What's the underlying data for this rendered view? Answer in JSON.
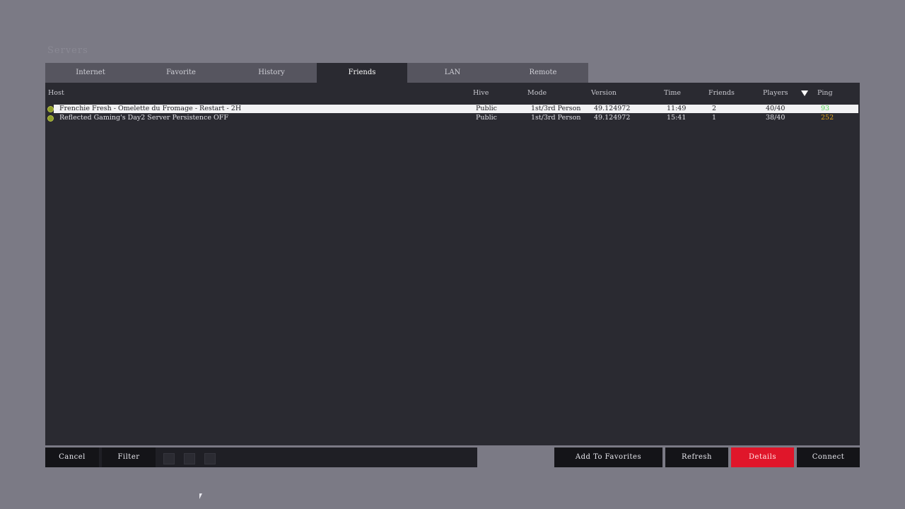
{
  "window": {
    "title": "Servers"
  },
  "tabs": [
    {
      "label": "Internet",
      "active": false
    },
    {
      "label": "Favorite",
      "active": false
    },
    {
      "label": "History",
      "active": false
    },
    {
      "label": "Friends",
      "active": true
    },
    {
      "label": "LAN",
      "active": false
    },
    {
      "label": "Remote",
      "active": false
    }
  ],
  "table": {
    "columns": [
      "Host",
      "Hive",
      "Mode",
      "Version",
      "Time",
      "Friends",
      "Players",
      "Ping"
    ],
    "rows": [
      {
        "host": "Frenchie Fresh - Omelette du Fromage - Restart - 2H",
        "hive": "Public",
        "mode": "1st/3rd Person",
        "version": "49.124972",
        "time": "11:49",
        "friends": "2",
        "players": "40/40",
        "ping": "93",
        "ping_color": "#4fd14f",
        "selected": true
      },
      {
        "host": "Reflected Gaming's Day2 Server Persistence OFF",
        "hive": "Public",
        "mode": "1st/3rd Person",
        "version": "49.124972",
        "time": "15:41",
        "friends": "1",
        "players": "38/40",
        "ping": "252",
        "ping_color": "#e0a31c",
        "selected": false
      }
    ]
  },
  "buttons": {
    "cancel": "Cancel",
    "filter": "Filter",
    "add_favorites": "Add To Favorites",
    "refresh": "Refresh",
    "details": "Details",
    "connect": "Connect"
  },
  "colors": {
    "accent": "#e0162a",
    "panel": "#2a2a31",
    "background": "#7b7a85"
  }
}
